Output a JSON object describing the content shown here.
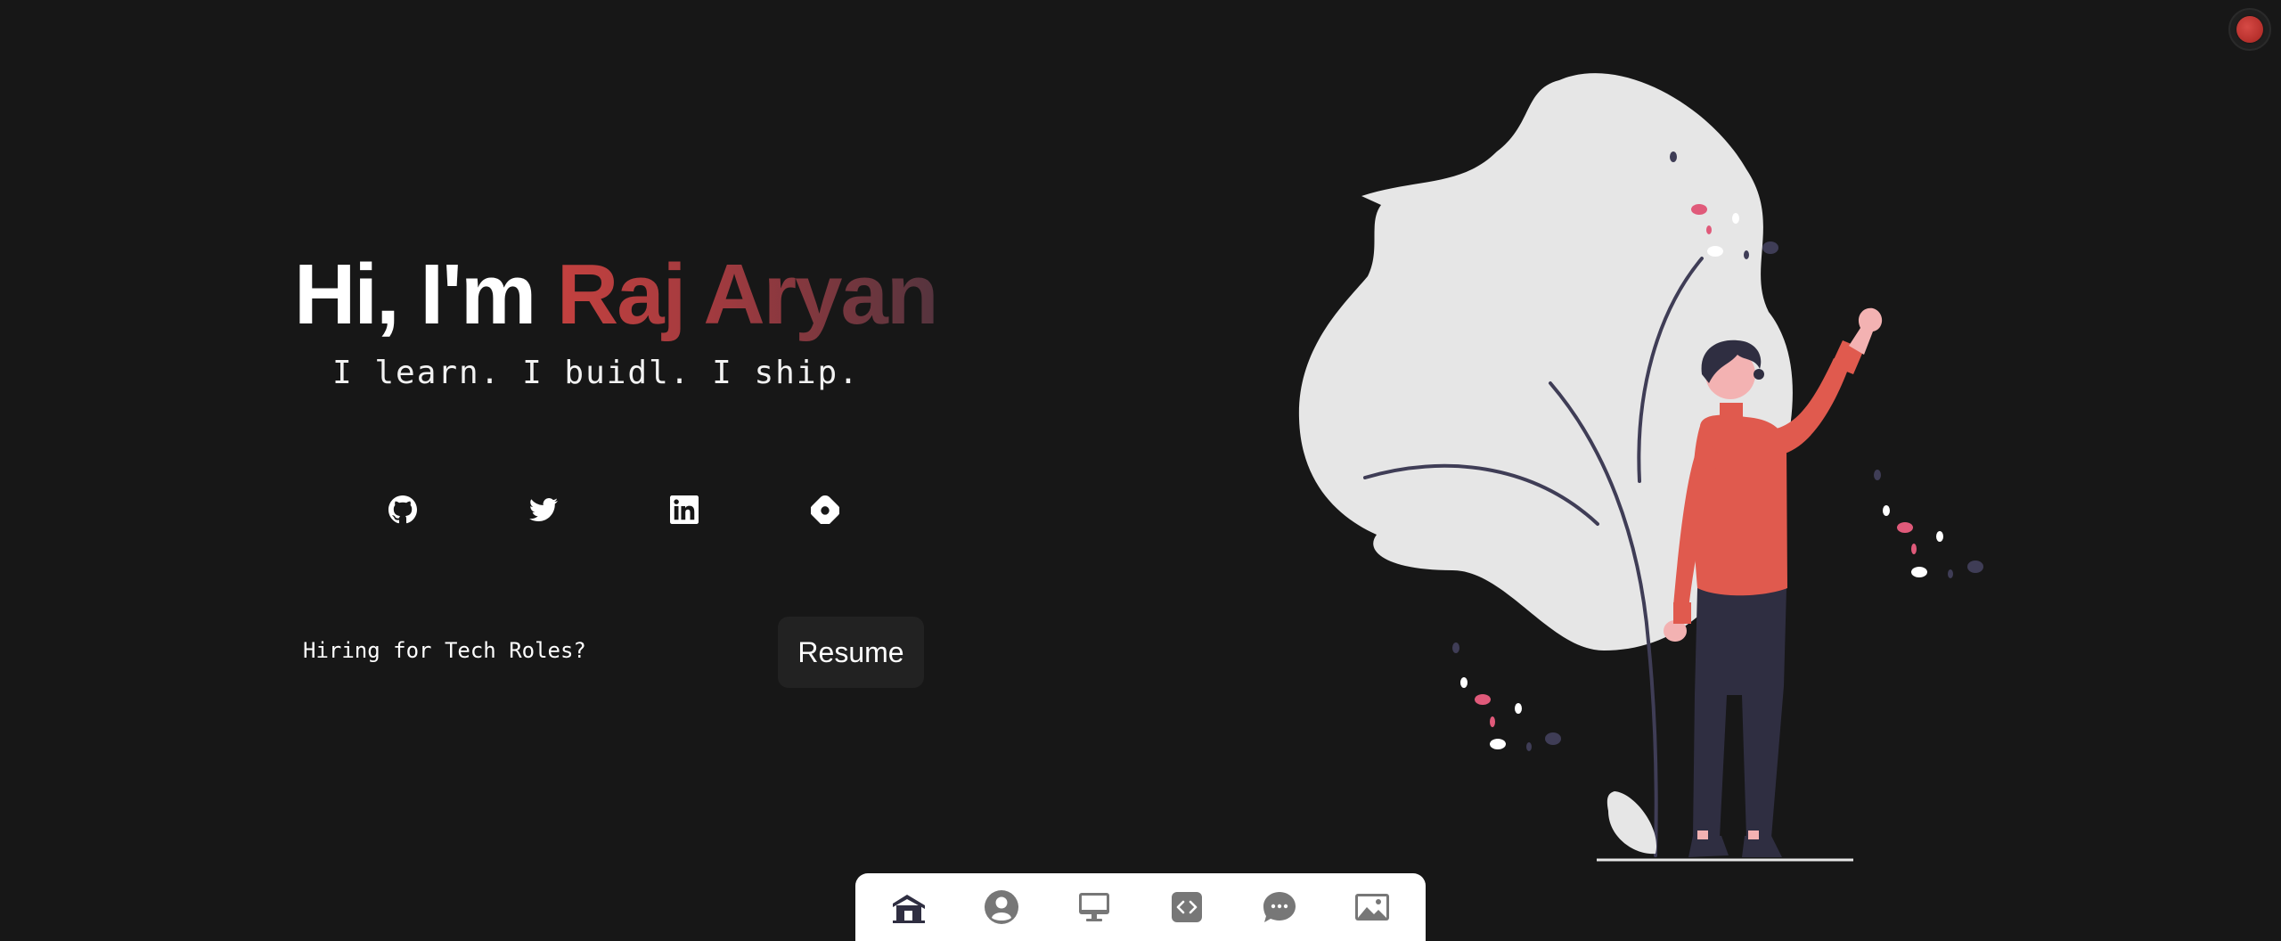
{
  "hero": {
    "greeting": "Hi, I'm",
    "name": "Raj Aryan",
    "tagline": "I learn. I buidl. I ship."
  },
  "socials": [
    {
      "icon": "github-icon"
    },
    {
      "icon": "twitter-icon"
    },
    {
      "icon": "linkedin-icon"
    },
    {
      "icon": "hashnode-icon"
    }
  ],
  "hiring": {
    "text": "Hiring for Tech Roles?",
    "button_label": "Resume"
  },
  "dock": {
    "items": [
      {
        "icon": "home-icon"
      },
      {
        "icon": "user-icon"
      },
      {
        "icon": "monitor-icon"
      },
      {
        "icon": "code-icon"
      },
      {
        "icon": "chat-icon"
      },
      {
        "icon": "image-icon"
      }
    ]
  },
  "colors": {
    "background": "#171717",
    "accent": "#c4413f",
    "illustration_shirt": "#e05a4e",
    "illustration_pants": "#2f2e41",
    "leaf": "#e6e6e6"
  }
}
